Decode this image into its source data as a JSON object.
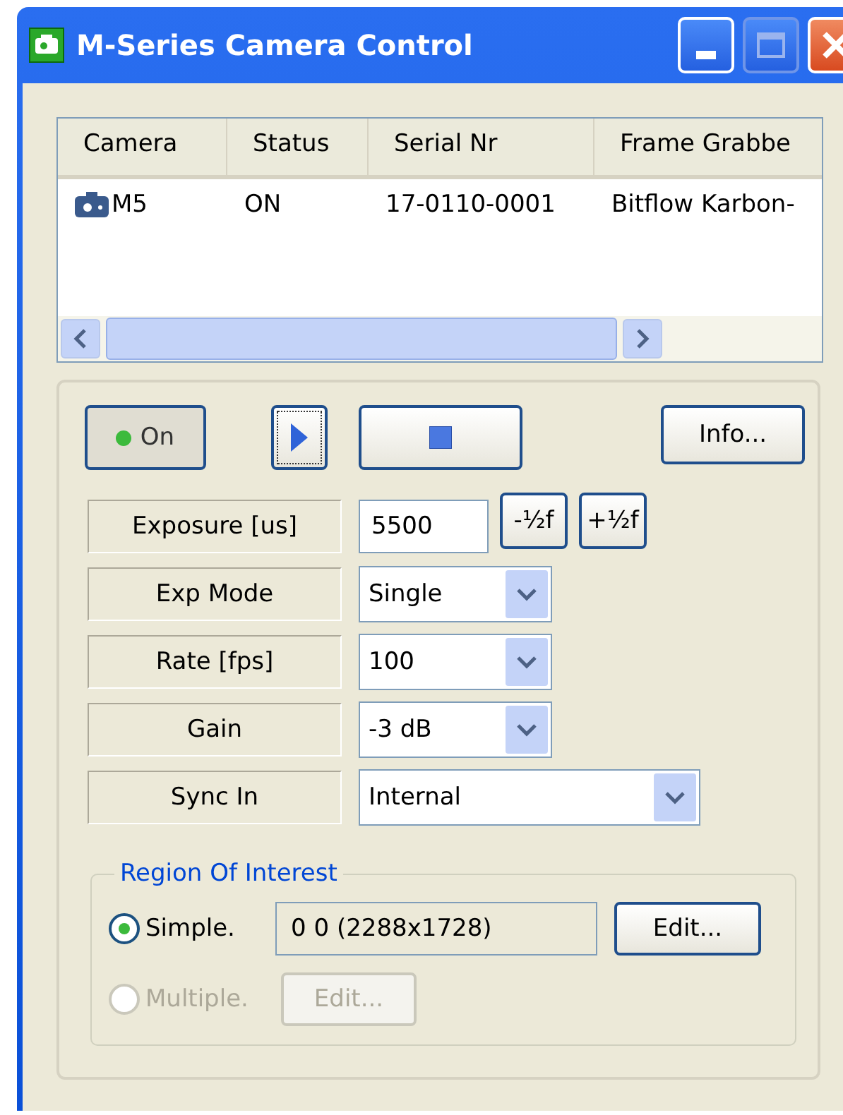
{
  "window": {
    "title": "M-Series Camera Control"
  },
  "camera_list": {
    "columns": [
      "Camera",
      "Status",
      "Serial Nr",
      "Frame Grabbe"
    ],
    "rows": [
      {
        "cells": [
          "M5",
          "ON",
          "17-0110-0001",
          "Bitflow Karbon-"
        ]
      }
    ]
  },
  "toolbar": {
    "power": {
      "label": "On",
      "on": true
    },
    "info": "Info..."
  },
  "params": [
    {
      "label": "Exposure [us]",
      "kind": "input",
      "value": "5500",
      "steps": [
        "-½f",
        "+½f"
      ]
    },
    {
      "label": "Exp Mode",
      "kind": "select",
      "value": "Single"
    },
    {
      "label": "Rate [fps]",
      "kind": "select",
      "value": "100"
    },
    {
      "label": "Gain",
      "kind": "select",
      "value": "-3 dB"
    },
    {
      "label": "Sync In",
      "kind": "wide-select",
      "value": "Internal"
    }
  ],
  "roi": {
    "title": "Region Of Interest",
    "options": [
      {
        "label": "Simple.",
        "selected": true,
        "disabled": false,
        "value": "0 0 (2288x1728)",
        "button": "Edit..."
      },
      {
        "label": "Multiple.",
        "selected": false,
        "disabled": true,
        "button": "Edit..."
      }
    ]
  }
}
